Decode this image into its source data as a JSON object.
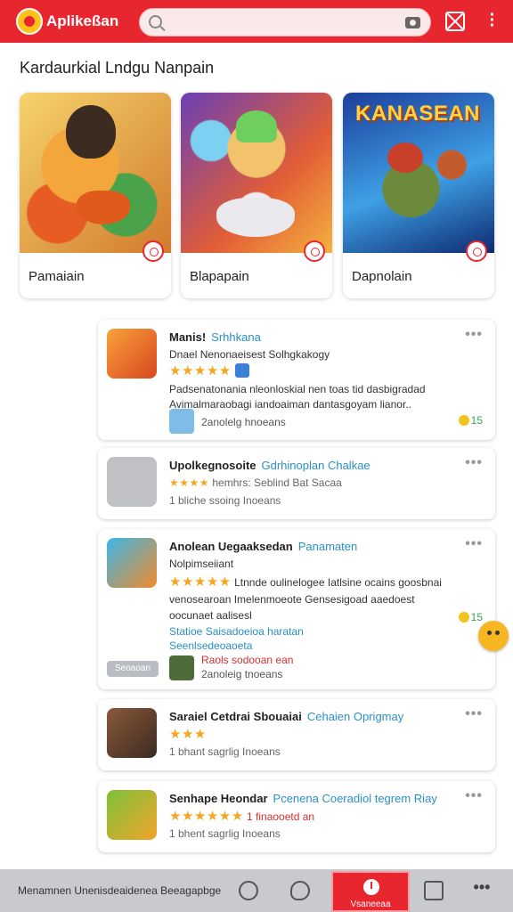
{
  "app": {
    "title": "Aplikeßan"
  },
  "header": {
    "search_placeholder": ""
  },
  "section": {
    "title": "Kardaurkial Lndgu Nanpain"
  },
  "featured": [
    {
      "label": "Pamaiain",
      "image_title": ""
    },
    {
      "label": "Blapapain",
      "image_title": ""
    },
    {
      "label": "Dapnolain",
      "image_title": "KANASEAN"
    }
  ],
  "apps": [
    {
      "name": "Manis!",
      "developer": "Srhhkana",
      "line1": "Dnael Nenonaeisest  Solhgkakogy",
      "rating": "★★★★★",
      "desc1": "Padsenatonania nleonloskial nen toas tid dasbigradad",
      "desc2": "Avimalmaraobagi iandoaiman dantasgoyam lianor..",
      "mini_text": "2anolelg hnoeans",
      "emoji_count": "15"
    },
    {
      "name": "Upolkegnosoite",
      "developer": "Gdrhinoplan Chalkae",
      "line1": "hemhrs: Seblind Bat Sacaa",
      "rating": "★★★★",
      "mini_text": "1 bliche ssoing Inoeans"
    },
    {
      "name": "Anolean Uegaaksedan",
      "developer": "Panamaten",
      "line1": "Nolpimseiiant",
      "rating": "★★★★★",
      "desc1": "Ltnnde oulinelogee Iatlsine ocains goosbnai",
      "desc2": "venosearoan Imelenmoeote Gensesigoad aaedoest",
      "desc3": "oocunaet aalisesl",
      "highlight1": "Statioe  Saisadoeioa  haratan",
      "highlight2": "Seenlsedeoaoeta",
      "mini_title": "Raols sodooan ean",
      "mini_text": "2anoleig tnoeans",
      "tag": "Seoaoan",
      "emoji_count": "15"
    },
    {
      "name": "Saraiel Cetdrai Sbouaiai",
      "developer": "Cehaien Oprigmay",
      "rating": "★★★",
      "mini_text": "1 bhant sagrlig Inoeans"
    },
    {
      "name": "Senhape Heondar",
      "developer": "Pcenena Coeradiol tegrem Riay",
      "rating": "★★★★★★",
      "rating_extra": "1 finaooetd an",
      "mini_text": "1 bhent sagrlig Inoeans"
    }
  ],
  "bottom_nav": {
    "text": "Menamnen Unenisdeaidenea Beeagapbge",
    "active_label": "Vsaneeaa"
  }
}
